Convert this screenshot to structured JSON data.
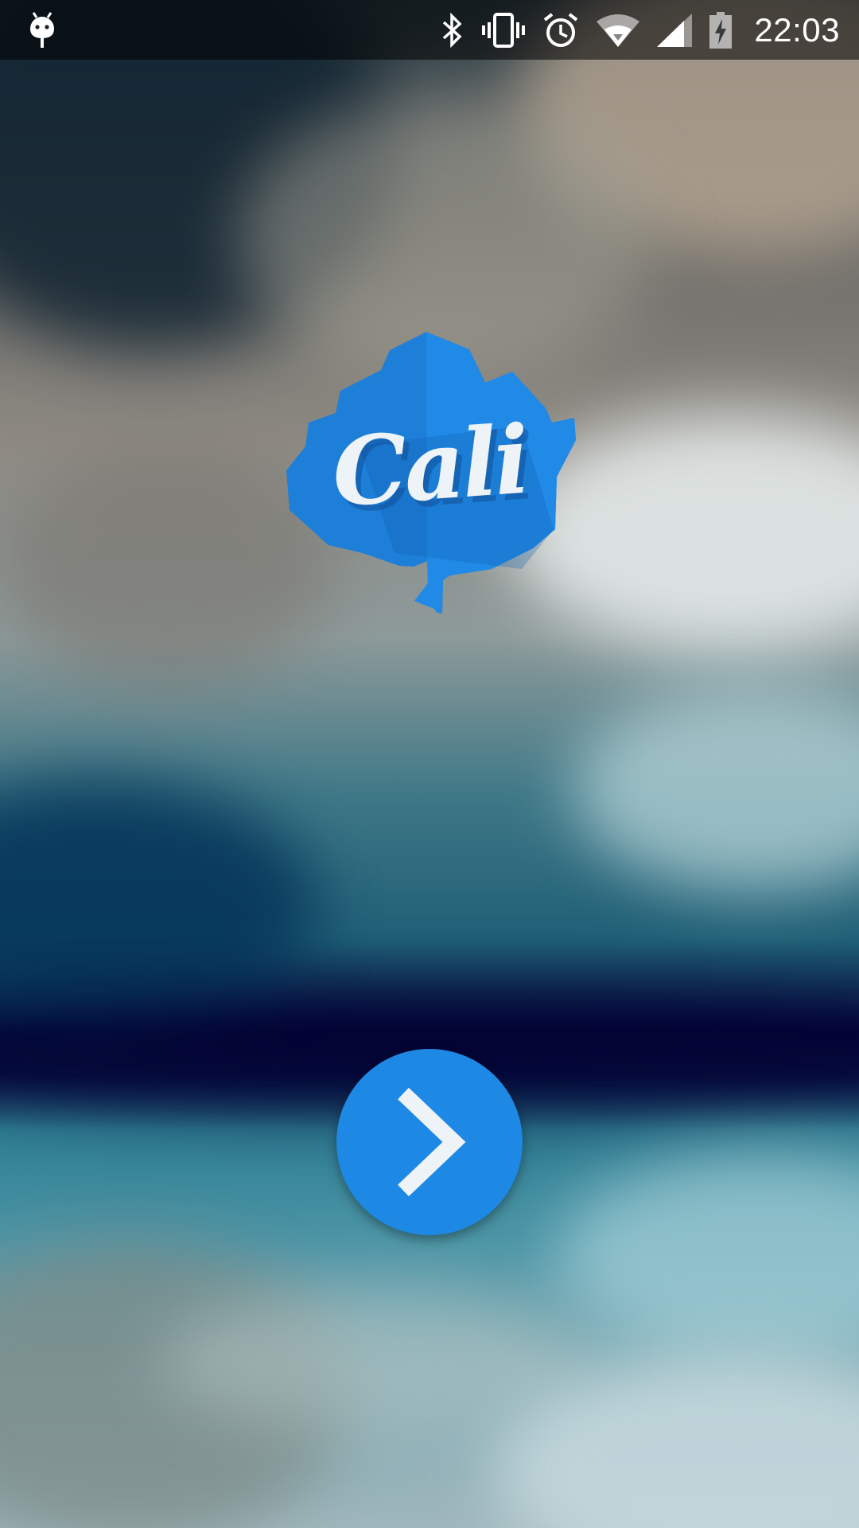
{
  "status_bar": {
    "time": "22:03",
    "icons": [
      "android-notification-icon",
      "bluetooth-icon",
      "vibrate-icon",
      "alarm-icon",
      "wifi-icon",
      "cell-signal-icon",
      "battery-charging-icon"
    ]
  },
  "logo": {
    "text": "Cali",
    "icon": "leaf-icon",
    "color": "#1e88e5"
  },
  "next_button": {
    "icon": "chevron-right-icon",
    "color": "#1e88e5"
  },
  "colors": {
    "accent": "#1e88e5",
    "icon_light": "#eef3f7"
  }
}
